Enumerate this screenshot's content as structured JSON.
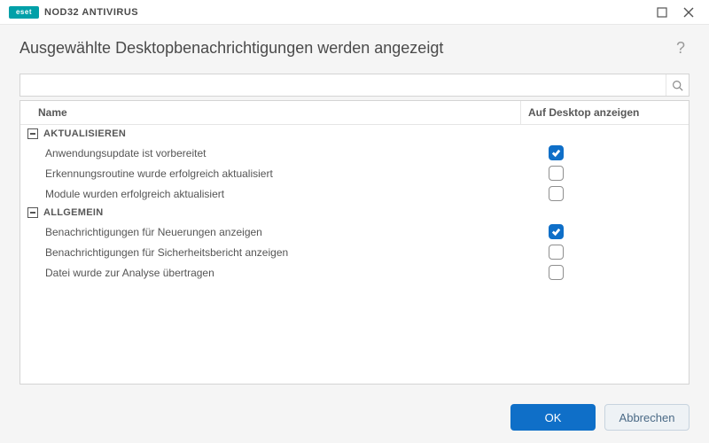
{
  "window": {
    "brand_logo_text": "eset",
    "brand_product": "NOD32 ANTIVIRUS"
  },
  "page": {
    "heading": "Ausgewählte Desktopbenachrichtigungen werden angezeigt"
  },
  "search": {
    "value": "",
    "placeholder": ""
  },
  "table": {
    "headers": {
      "name": "Name",
      "show": "Auf Desktop anzeigen"
    },
    "groups": [
      {
        "label": "AKTUALISIEREN",
        "rows": [
          {
            "name": "Anwendungsupdate ist vorbereitet",
            "checked": true
          },
          {
            "name": "Erkennungsroutine wurde erfolgreich aktualisiert",
            "checked": false
          },
          {
            "name": "Module wurden erfolgreich aktualisiert",
            "checked": false
          }
        ]
      },
      {
        "label": "ALLGEMEIN",
        "rows": [
          {
            "name": "Benachrichtigungen für Neuerungen anzeigen",
            "checked": true
          },
          {
            "name": "Benachrichtigungen für Sicherheitsbericht anzeigen",
            "checked": false
          },
          {
            "name": "Datei wurde zur Analyse übertragen",
            "checked": false
          }
        ]
      }
    ]
  },
  "footer": {
    "ok": "OK",
    "cancel": "Abbrechen"
  },
  "help_glyph": "?"
}
